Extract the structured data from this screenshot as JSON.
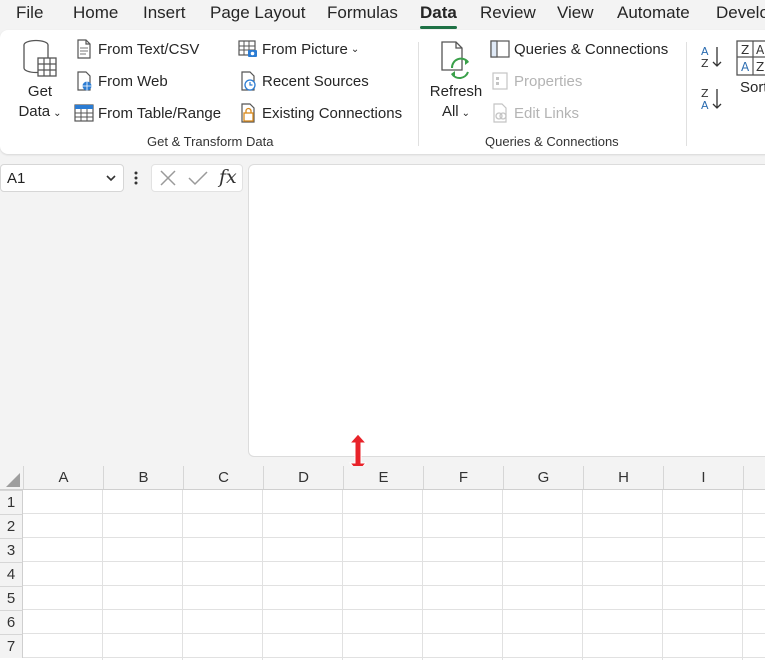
{
  "menu": {
    "items": [
      "File",
      "Home",
      "Insert",
      "Page Layout",
      "Formulas",
      "Data",
      "Review",
      "View",
      "Automate",
      "Develo"
    ],
    "active_index": 5
  },
  "ribbon": {
    "get_data": {
      "line1": "Get",
      "line2": "Data"
    },
    "from_text_csv": "From Text/CSV",
    "from_web": "From Web",
    "from_table_range": "From Table/Range",
    "from_picture": "From Picture",
    "recent_sources": "Recent Sources",
    "existing_connections": "Existing Connections",
    "group1_label": "Get & Transform Data",
    "refresh_all": {
      "line1": "Refresh",
      "line2": "All"
    },
    "queries_connections": "Queries & Connections",
    "properties": "Properties",
    "edit_links": "Edit Links",
    "group2_label": "Queries & Connections",
    "sort": "Sort"
  },
  "formula_bar": {
    "name_box_value": "A1",
    "fx_label": "fx"
  },
  "grid": {
    "columns": [
      "A",
      "B",
      "C",
      "D",
      "E",
      "F",
      "G",
      "H",
      "I"
    ],
    "rows": [
      "1",
      "2",
      "3",
      "4",
      "5",
      "6",
      "7"
    ]
  },
  "colors": {
    "accent_green": "#1e7145",
    "cursor_red": "#e8232a"
  }
}
